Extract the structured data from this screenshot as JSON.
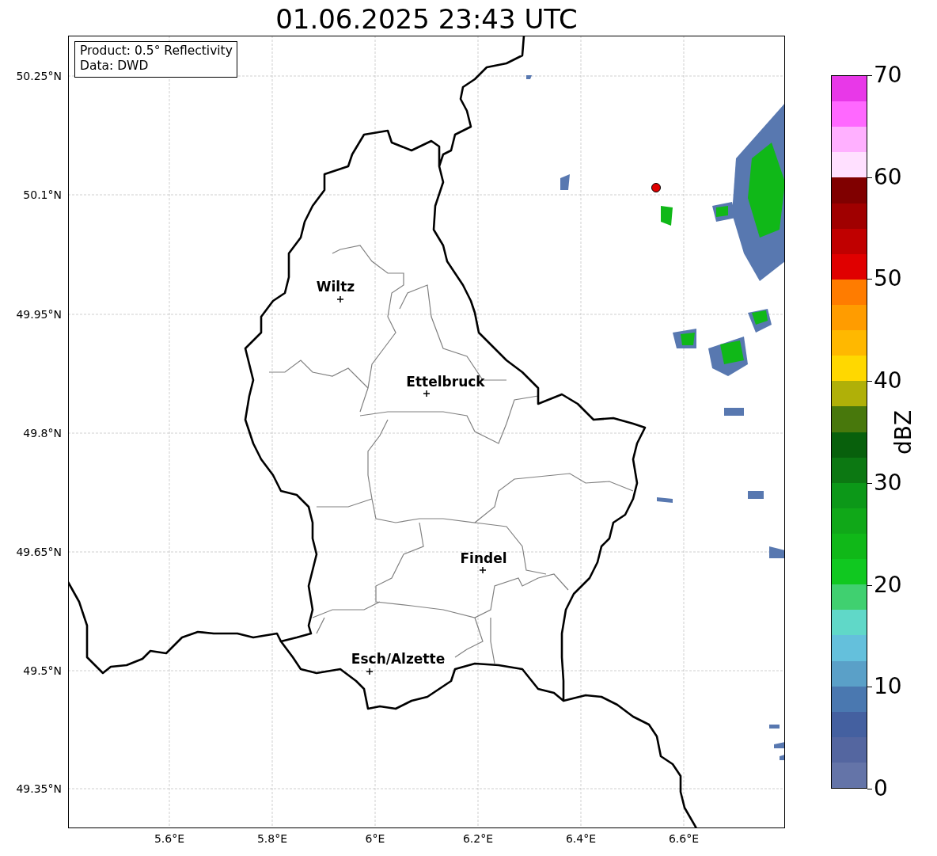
{
  "title": "01.06.2025 23:43 UTC",
  "info_box": {
    "lines": [
      "Product: 0.5° Reflectivity",
      "Data: DWD"
    ]
  },
  "latitude_ticks": [
    "50.25°N",
    "50.1°N",
    "49.95°N",
    "49.8°N",
    "49.65°N",
    "49.5°N",
    "49.35°N"
  ],
  "longitude_ticks": [
    "5.6°E",
    "5.8°E",
    "6°E",
    "6.2°E",
    "6.4°E",
    "6.6°E"
  ],
  "cities": [
    {
      "name": "Wiltz"
    },
    {
      "name": "Ettelbruck"
    },
    {
      "name": "Findel"
    },
    {
      "name": "Esch/Alzette"
    }
  ],
  "colorbar": {
    "label": "dBZ",
    "ticks": [
      "70",
      "60",
      "50",
      "40",
      "30",
      "20",
      "10",
      "0"
    ],
    "levels": [
      {
        "color": "#e838e8"
      },
      {
        "color": "#ff68ff"
      },
      {
        "color": "#ffb0ff"
      },
      {
        "color": "#ffe0ff"
      },
      {
        "color": "#800000"
      },
      {
        "color": "#a00000"
      },
      {
        "color": "#c00000"
      },
      {
        "color": "#e00000"
      },
      {
        "color": "#ff7c00"
      },
      {
        "color": "#ff9c00"
      },
      {
        "color": "#ffb800"
      },
      {
        "color": "#ffd800"
      },
      {
        "color": "#b0b008"
      },
      {
        "color": "#48780c"
      },
      {
        "color": "#08600c"
      },
      {
        "color": "#0c7812"
      },
      {
        "color": "#0c9818"
      },
      {
        "color": "#10a818"
      },
      {
        "color": "#10b818"
      },
      {
        "color": "#10c820"
      },
      {
        "color": "#40d070"
      },
      {
        "color": "#60d8c8"
      },
      {
        "color": "#64c0dc"
      },
      {
        "color": "#5aa0c8"
      },
      {
        "color": "#4a78b0"
      },
      {
        "color": "#4460a0"
      },
      {
        "color": "#5466a0"
      },
      {
        "color": "#6474a8"
      }
    ]
  }
}
